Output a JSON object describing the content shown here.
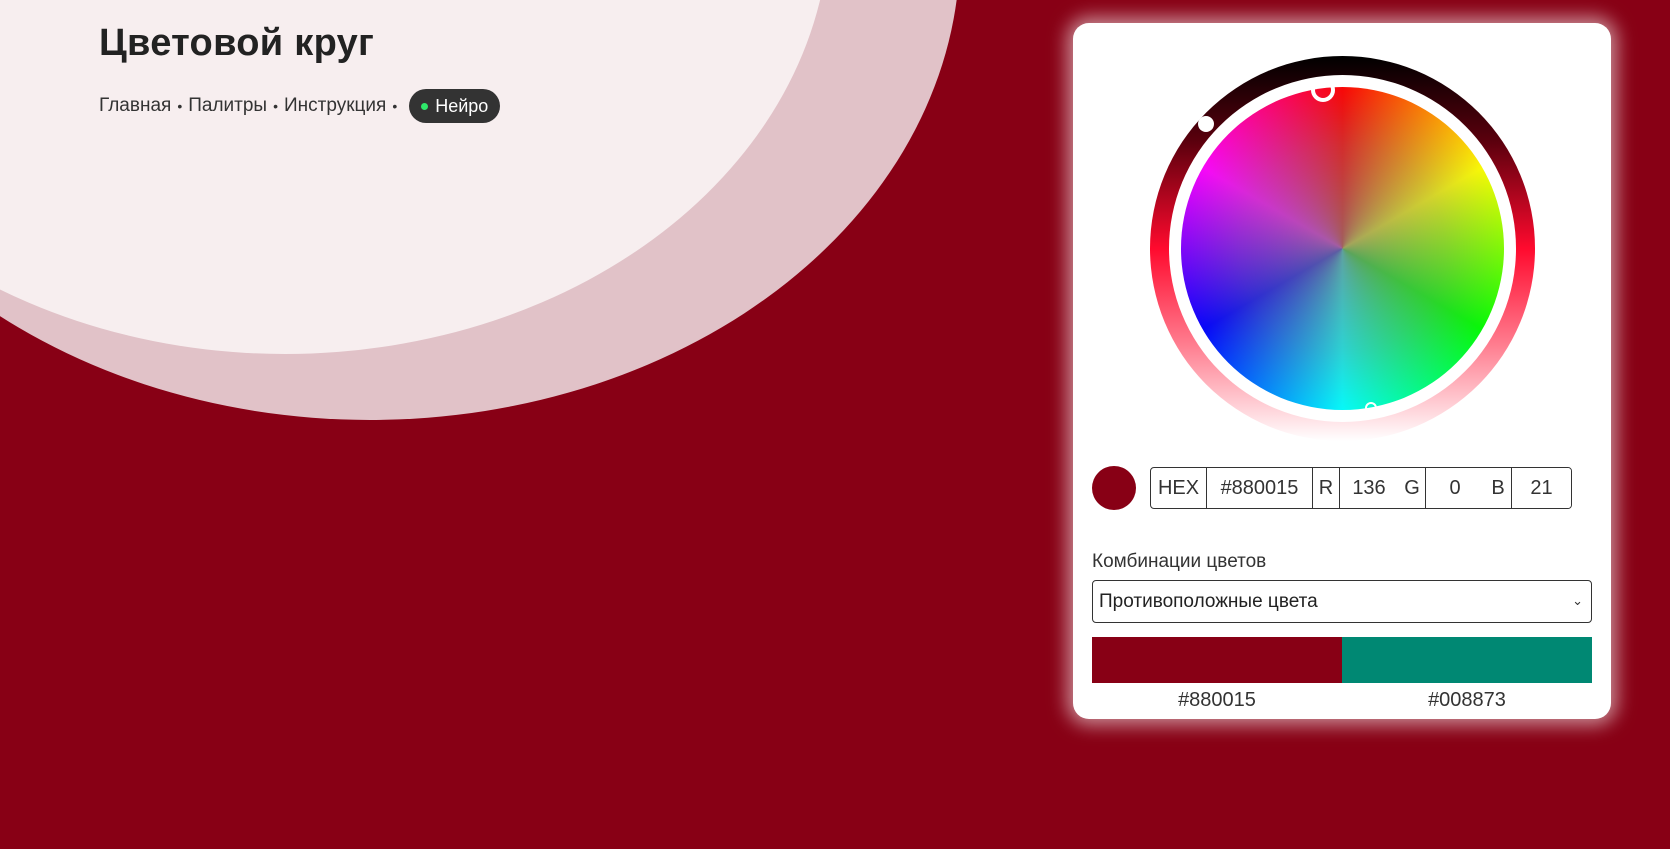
{
  "header": {
    "title": "Цветовой круг",
    "nav": [
      {
        "label": "Главная"
      },
      {
        "label": "Палитры"
      },
      {
        "label": "Инструкция"
      }
    ],
    "separator": "•",
    "neiro_label": "Нейро"
  },
  "picker": {
    "current_color": "#880015",
    "fields": {
      "hex_label": "HEX",
      "hex_value": "#880015",
      "r_label": "R",
      "r_value": "136",
      "g_label": "G",
      "g_value": "0",
      "b_label": "B",
      "b_value": "21"
    },
    "combinations_label": "Комбинации цветов",
    "combinations_selected": "Противоположные цвета",
    "palette": [
      {
        "color": "#880015",
        "code": "#880015"
      },
      {
        "color": "#008873",
        "code": "#008873"
      }
    ]
  },
  "colors": {
    "background": "#880015",
    "accent_dot": "#2ee86a"
  }
}
